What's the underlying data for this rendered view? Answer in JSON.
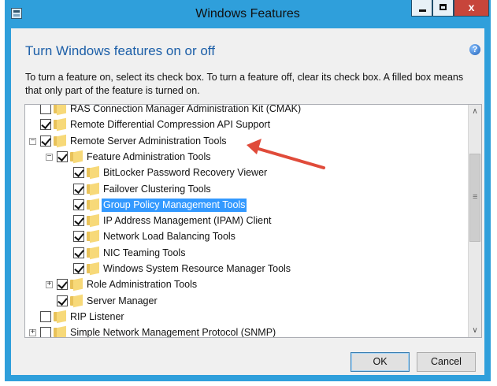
{
  "window": {
    "title": "Windows Features",
    "app_icon": "windows-features-icon",
    "minimize_icon": "minimize-icon",
    "maximize_icon": "maximize-icon",
    "close_glyph": "x"
  },
  "dialog": {
    "heading": "Turn Windows features on or off",
    "help_glyph": "?",
    "description": "To turn a feature on, select its check box. To turn a feature off, clear its check box. A filled box means that only part of the feature is turned on."
  },
  "tree": {
    "items": [
      {
        "label": "RAS Connection Manager Administration Kit (CMAK)",
        "checked": false,
        "expander": "",
        "level": 0
      },
      {
        "label": "Remote Differential Compression API Support",
        "checked": true,
        "expander": "",
        "level": 0
      },
      {
        "label": "Remote Server Administration Tools",
        "checked": true,
        "expander": "−",
        "level": 0
      },
      {
        "label": "Feature Administration Tools",
        "checked": true,
        "expander": "−",
        "level": 1
      },
      {
        "label": "BitLocker Password Recovery Viewer",
        "checked": true,
        "expander": "",
        "level": 2
      },
      {
        "label": "Failover Clustering Tools",
        "checked": true,
        "expander": "",
        "level": 2
      },
      {
        "label": "Group Policy Management Tools",
        "checked": true,
        "expander": "",
        "level": 2,
        "selected": true
      },
      {
        "label": "IP Address Management (IPAM) Client",
        "checked": true,
        "expander": "",
        "level": 2
      },
      {
        "label": "Network Load Balancing Tools",
        "checked": true,
        "expander": "",
        "level": 2
      },
      {
        "label": "NIC Teaming Tools",
        "checked": true,
        "expander": "",
        "level": 2
      },
      {
        "label": "Windows System Resource Manager Tools",
        "checked": true,
        "expander": "",
        "level": 2
      },
      {
        "label": "Role Administration Tools",
        "checked": true,
        "expander": "+",
        "level": 1
      },
      {
        "label": "Server Manager",
        "checked": true,
        "expander": "",
        "level": 1
      },
      {
        "label": "RIP Listener",
        "checked": false,
        "expander": "",
        "level": 0
      },
      {
        "label": "Simple Network Management Protocol (SNMP)",
        "checked": false,
        "expander": "+",
        "level": 0
      }
    ],
    "scroll_up_glyph": "∧",
    "scroll_down_glyph": "∨",
    "thumb_grip_glyph": "≡"
  },
  "buttons": {
    "ok": "OK",
    "cancel": "Cancel"
  },
  "annotation": {
    "arrow_color": "#e04b3a"
  }
}
